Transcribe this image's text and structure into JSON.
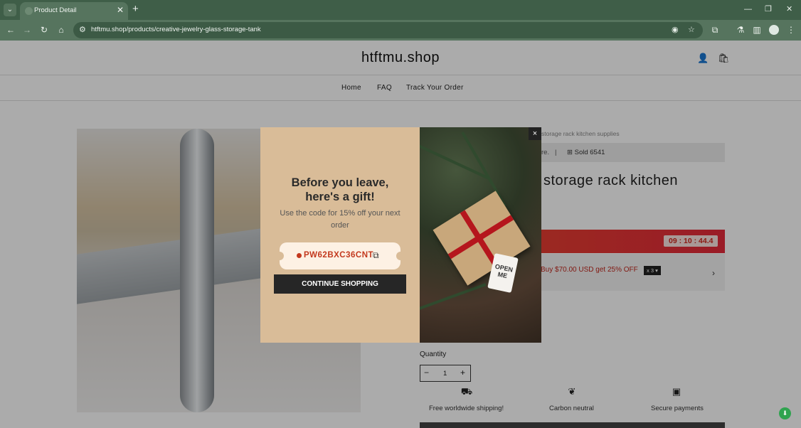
{
  "browser": {
    "tab_title": "Product Detail",
    "new_tab": "+",
    "url": "htftmu.shop/products/creative-jewelry-glass-storage-tank",
    "icons": [
      "tab-search-icon",
      "back-arrow-icon",
      "forward-arrow-icon",
      "reload-icon",
      "home-icon",
      "site-info-icon",
      "eye-off-icon",
      "star-icon",
      "extensions-icon",
      "lab-flask-icon",
      "side-panel-icon",
      "profile-icon",
      "more-vert-icon",
      "minimize-icon",
      "restore-icon",
      "close-icon"
    ]
  },
  "header": {
    "shop_name": "htftmu.shop",
    "nav": [
      "Home",
      "FAQ",
      "Track Your Order"
    ]
  },
  "product": {
    "breadcrumb": "storage rack kitchen supplies",
    "stock_text": "re.",
    "sold": "Sold 6541",
    "title": "storage rack kitchen",
    "timer": "09 : 10 : 44.4",
    "offer": "Buy $70.00 USD get 25% OFF",
    "offer_qty": "x 3",
    "quantity_label": "Quantity",
    "quantity_value": "1",
    "features": [
      "Free worldwide shipping!",
      "Carbon neutral",
      "Secure payments"
    ]
  },
  "modal": {
    "heading_line1": "Before you leave,",
    "heading_line2": "here's a gift!",
    "subtitle": "Use the code for 15% off your next order",
    "coupon_code": "PW62BXC36CNT",
    "cta": "CONTINUE SHOPPING",
    "close": "×",
    "tag_line1": "OPEN",
    "tag_line2": "ME"
  },
  "colors": {
    "chrome": "#3f5e48",
    "modal_panel": "#d9bc98",
    "coupon_text": "#c3381d",
    "timer_band": "#e62a3b"
  }
}
